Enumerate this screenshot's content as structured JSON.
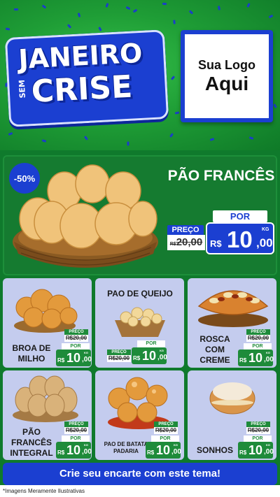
{
  "header": {
    "title_line1": "JANEIRO",
    "title_small": "SEM",
    "title_line2": "CRISE",
    "logo_line1": "Sua Logo",
    "logo_line2": "Aqui"
  },
  "featured": {
    "discount": "-50%",
    "name": "PÃO FRANCÊS",
    "preco_label": "PREÇO",
    "old_price_currency": "R$",
    "old_price": "20,00",
    "por_label": "POR",
    "currency": "R$",
    "price_int": "10",
    "price_dec": ",00",
    "unit": "KG"
  },
  "products": [
    {
      "name_line1": "BROA DE",
      "name_line2": "MILHO",
      "name_line3": "",
      "preco_label": "PREÇO",
      "old_price": "R$20,00",
      "por_label": "POR",
      "currency": "R$",
      "price_int": "10",
      "price_dec": ",00",
      "unit": "KG"
    },
    {
      "name_line1": "PAO DE QUEIJO",
      "name_line2": "",
      "name_line3": "",
      "preco_label": "PREÇO",
      "old_price": "R$20,00",
      "por_label": "POR",
      "currency": "R$",
      "price_int": "10",
      "price_dec": ",00",
      "unit": "KG"
    },
    {
      "name_line1": "ROSCA",
      "name_line2": "COM",
      "name_line3": "CREME",
      "preco_label": "PREÇO",
      "old_price": "R$20,00",
      "por_label": "POR",
      "currency": "R$",
      "price_int": "10",
      "price_dec": ",00",
      "unit": "KG"
    },
    {
      "name_line1": "PÃO",
      "name_line2": "FRANCÊS",
      "name_line3": "INTEGRAL",
      "preco_label": "PREÇO",
      "old_price": "R$20,00",
      "por_label": "POR",
      "currency": "R$",
      "price_int": "10",
      "price_dec": ",00",
      "unit": "KG"
    },
    {
      "name_line1": "PAO DE BATATA",
      "name_line2": "PADARIA",
      "name_line3": "",
      "preco_label": "PREÇO",
      "old_price": "R$20,00",
      "por_label": "POR",
      "currency": "R$",
      "price_int": "10",
      "price_dec": ",00",
      "unit": "KG"
    },
    {
      "name_line1": "SONHOS",
      "name_line2": "",
      "name_line3": "",
      "preco_label": "PREÇO",
      "old_price": "R$20,00",
      "por_label": "POR",
      "currency": "R$",
      "price_int": "10",
      "price_dec": ",00",
      "unit": "KG"
    }
  ],
  "cta": "Crie seu encarte com este tema!",
  "disclaimer": "*Imagens Meramente Ilustrativas",
  "colors": {
    "green_dark": "#0f7a2c",
    "green_bright": "#35c04a",
    "blue": "#1b3fd1",
    "card_bg": "#c4ccee"
  }
}
